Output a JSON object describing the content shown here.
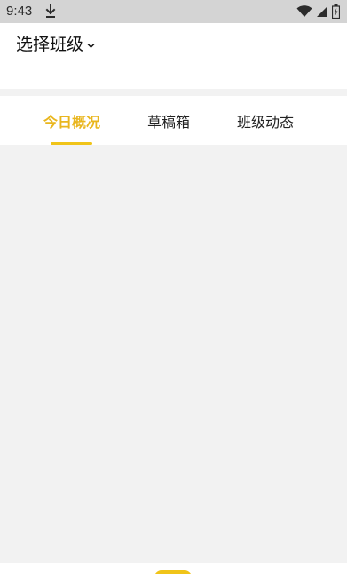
{
  "status_bar": {
    "time": "9:43",
    "download_icon": "download-arrow-icon",
    "wifi_icon": "wifi-icon",
    "signal_icon": "cell-signal-icon",
    "battery_icon": "battery-icon"
  },
  "header": {
    "class_selector_label": "选择班级",
    "chevron_icon": "chevron-down-icon"
  },
  "tabs": [
    {
      "label": "今日概况",
      "active": true
    },
    {
      "label": "草稿箱",
      "active": false
    },
    {
      "label": "班级动态",
      "active": false
    }
  ],
  "colors": {
    "accent": "#f0c419",
    "accent_text": "#e9b61e",
    "background": "#f2f2f2",
    "status_bar": "#d4d4d4"
  }
}
